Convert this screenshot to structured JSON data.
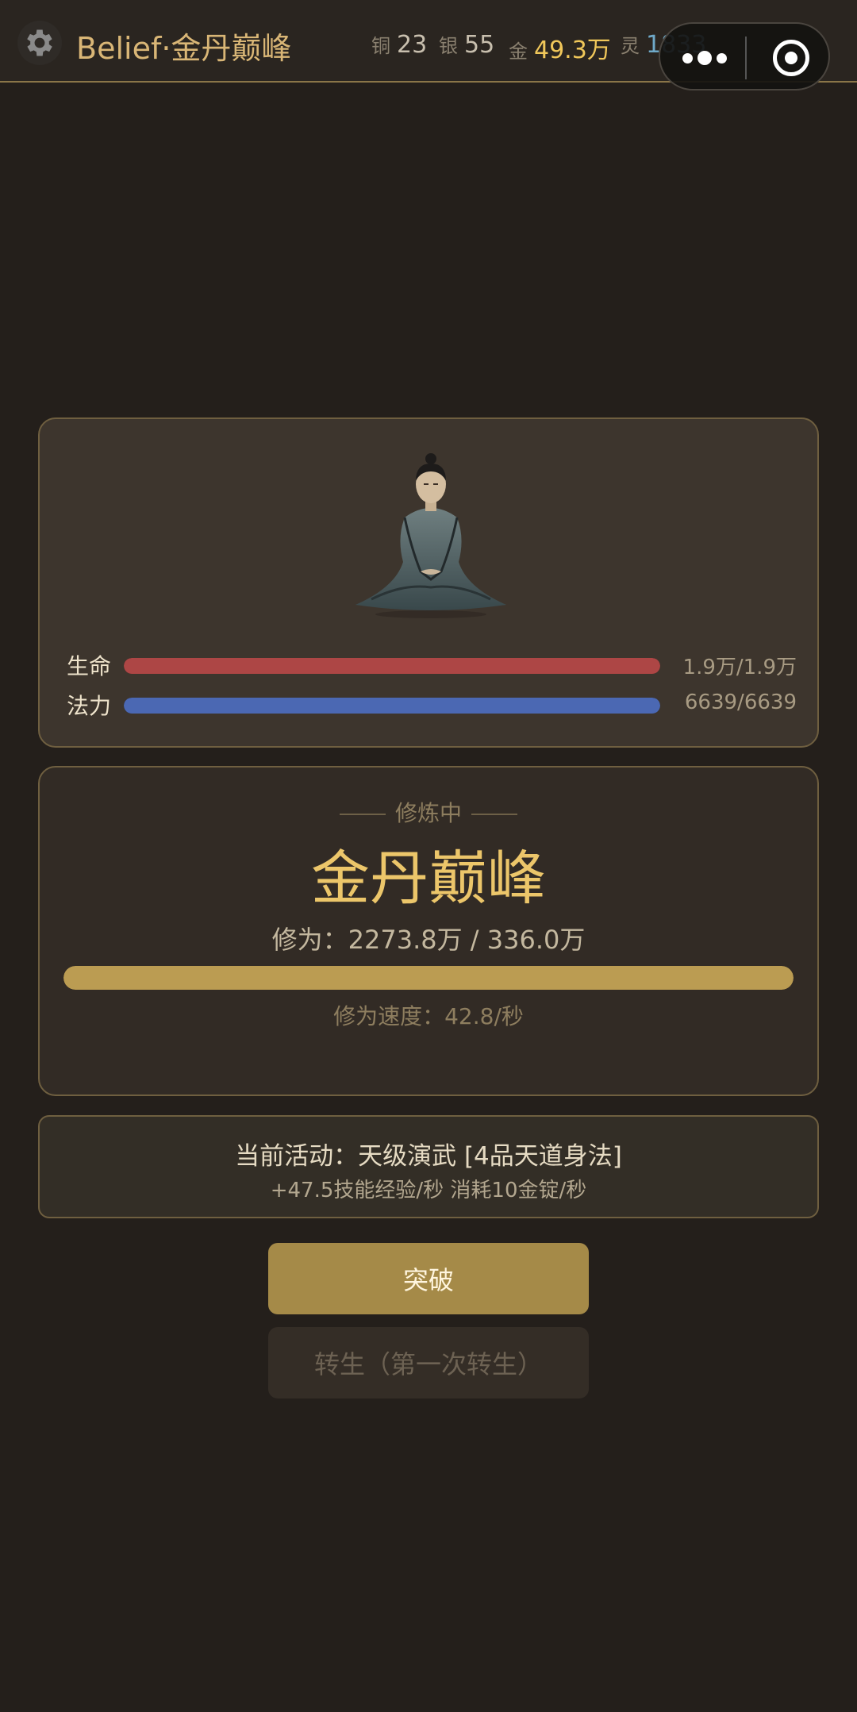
{
  "header": {
    "title": "Belief·金丹巅峰",
    "currencies": {
      "copper": {
        "label": "铜",
        "value": "23"
      },
      "silver": {
        "label": "银",
        "value": "55"
      },
      "gold": {
        "label": "金",
        "value": "49.3万"
      },
      "spirit": {
        "label": "灵",
        "value": "1833"
      }
    }
  },
  "character": {
    "hp": {
      "label": "生命",
      "value": "1.9万/1.9万",
      "fill_fraction": 1.0,
      "color": "#ad4645"
    },
    "mp": {
      "label": "法力",
      "value": "6639/6639",
      "fill_fraction": 1.0,
      "color": "#4b68b3"
    }
  },
  "cultivation": {
    "status": "修炼中",
    "realm": "金丹巅峰",
    "progress_text": "修为：2273.8万 / 336.0万",
    "progress_fraction": 1.0,
    "speed_text": "修为速度：42.8/秒"
  },
  "activity": {
    "line1": "当前活动：天级演武 [4品天道身法]",
    "line2": "+47.5技能经验/秒  消耗10金锭/秒"
  },
  "buttons": {
    "breakthrough": "突破",
    "rebirth": "转生（第一次转生）"
  },
  "colors": {
    "accent_gold": "#ecc66a",
    "cultivation_bar": "#bb9c52",
    "spirit": "#6fa9c8"
  },
  "icons": [
    "gear-icon",
    "more-dots-icon",
    "target-close-icon",
    "meditating-monk-portrait"
  ]
}
